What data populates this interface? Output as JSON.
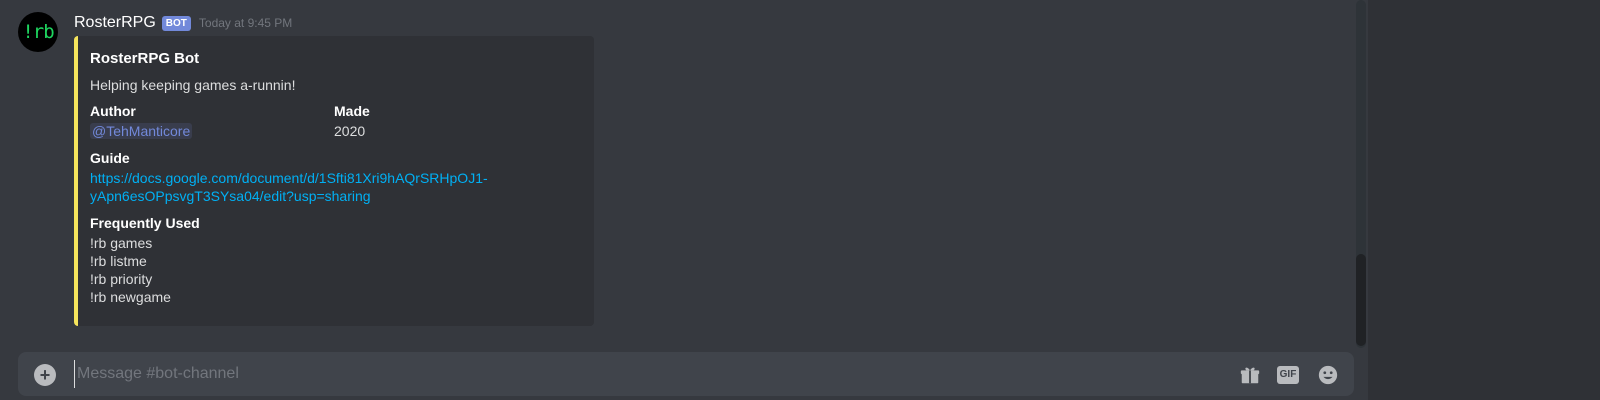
{
  "message": {
    "avatar_text": "!rb",
    "username": "RosterRPG",
    "bot_tag": "BOT",
    "timestamp": "Today at 9:45 PM"
  },
  "embed": {
    "accent_color": "#f6e55c",
    "title": "RosterRPG Bot",
    "description": "Helping keeping games a-runnin!",
    "fields": {
      "author": {
        "name": "Author",
        "value": "@TehManticore"
      },
      "made": {
        "name": "Made",
        "value": "2020"
      },
      "guide": {
        "name": "Guide",
        "value": "https://docs.google.com/document/d/1Sfti81Xri9hAQrSRHpOJ1-yApn6esOPpsvgT3SYsa04/edit?usp=sharing"
      },
      "frequently_used": {
        "name": "Frequently Used",
        "items": [
          "!rb games",
          "!rb listme",
          "!rb priority",
          "!rb newgame"
        ]
      }
    }
  },
  "input": {
    "placeholder": "Message #bot-channel",
    "value": "",
    "gif_label": "GIF"
  },
  "icons": {
    "plus": "plus-circle-icon",
    "gift": "gift-icon",
    "gif": "gif-icon",
    "emoji": "emoji-icon"
  }
}
